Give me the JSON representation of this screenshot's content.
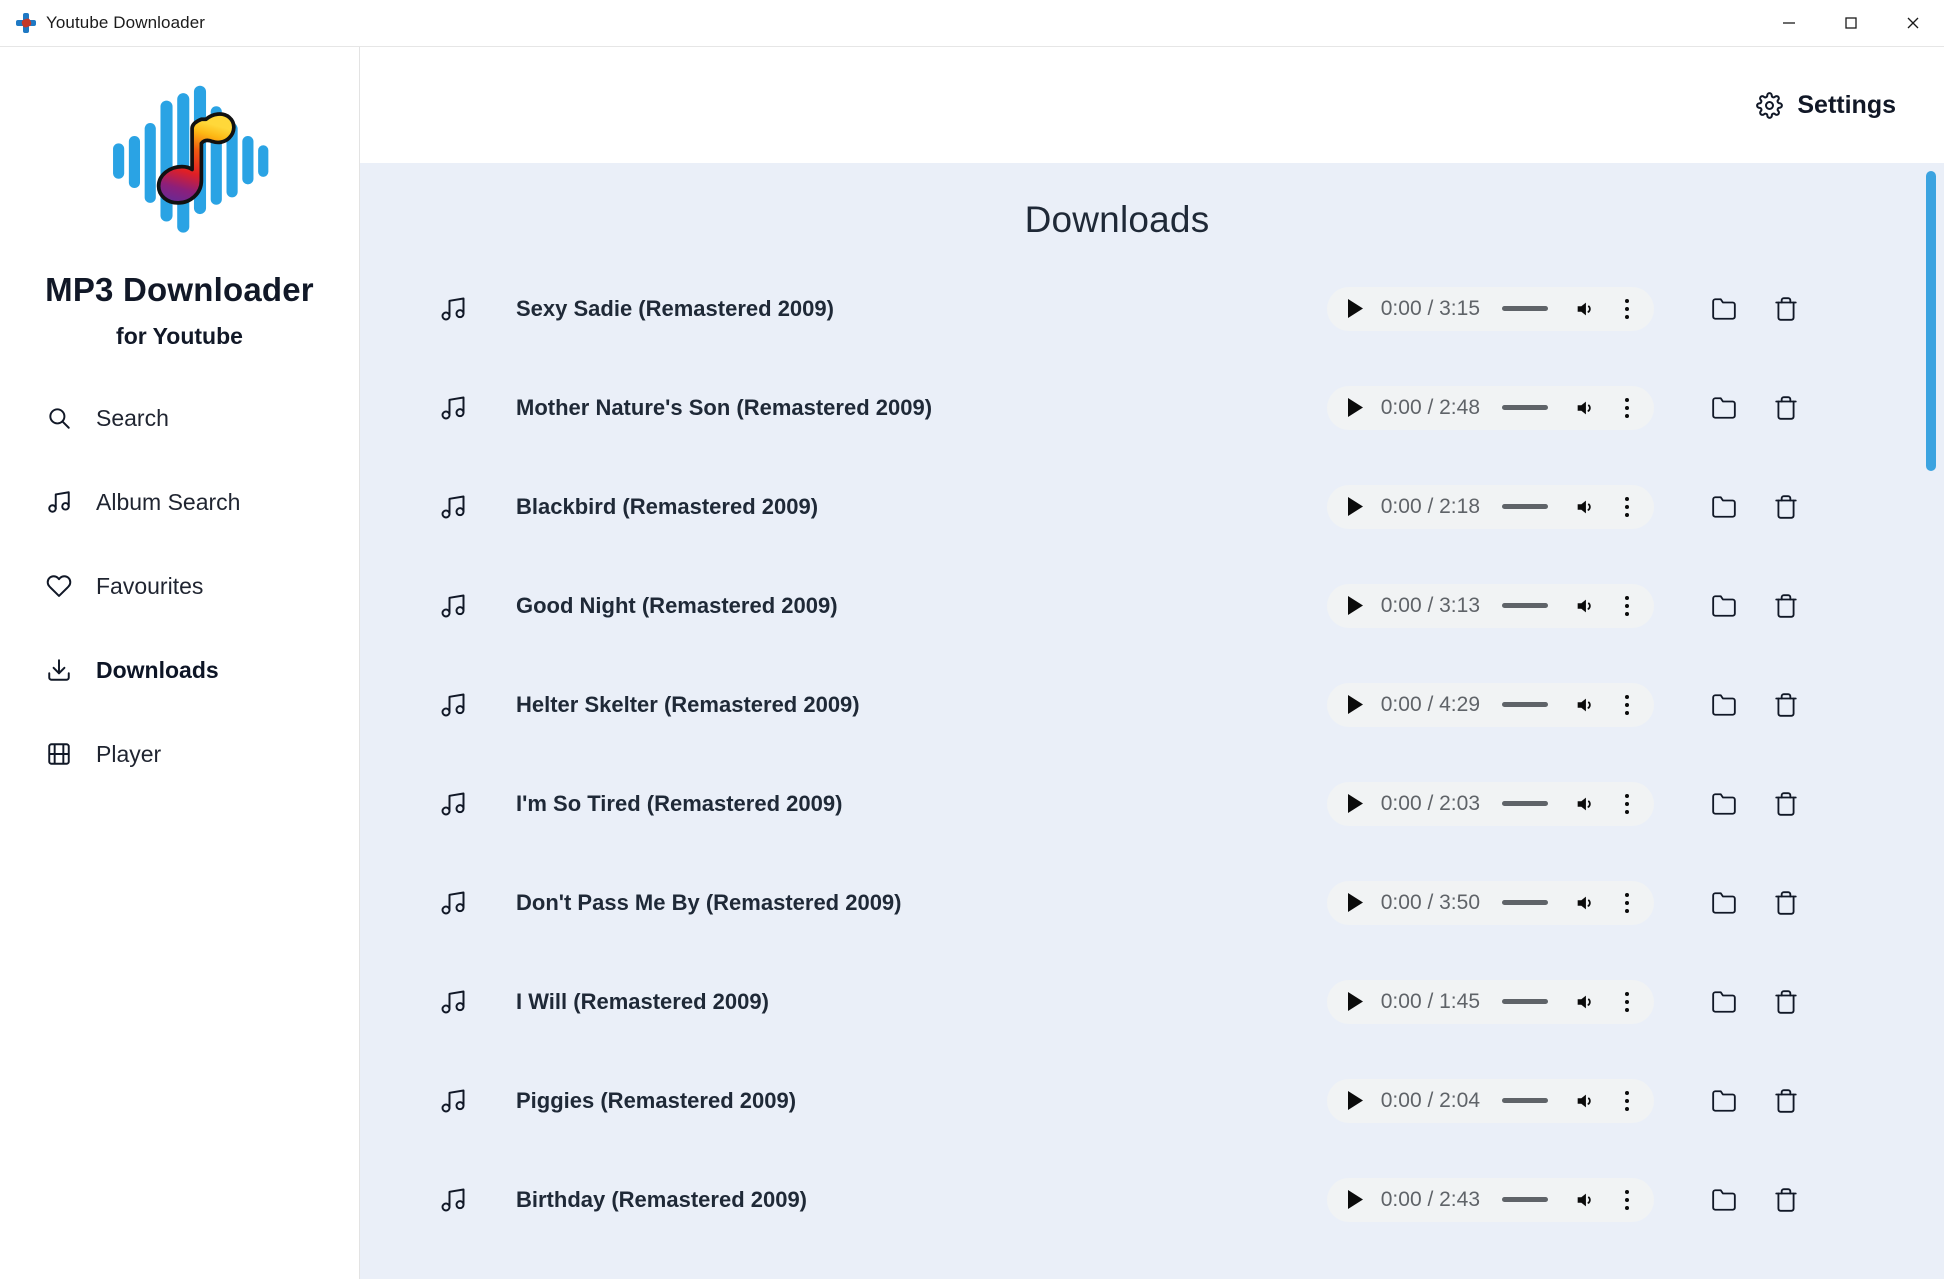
{
  "window": {
    "title": "Youtube Downloader",
    "app_icon": "app-logo-icon",
    "minimize_label": "—",
    "maximize_label": "□",
    "close_label": "×"
  },
  "sidebar": {
    "logo_icon": "waveform-music-note-logo",
    "brand": "MP3 Downloader",
    "brand_sub": "for Youtube",
    "items": [
      {
        "label": "Search",
        "icon": "search-icon",
        "active": false
      },
      {
        "label": "Album Search",
        "icon": "music-note-icon",
        "active": false
      },
      {
        "label": "Favourites",
        "icon": "heart-icon",
        "active": false
      },
      {
        "label": "Downloads",
        "icon": "download-icon",
        "active": true
      },
      {
        "label": "Player",
        "icon": "film-icon",
        "active": false
      }
    ]
  },
  "topbar": {
    "settings_label": "Settings",
    "settings_icon": "gear-icon"
  },
  "main": {
    "page_title": "Downloads",
    "colors": {
      "content_bg": "#eaeff8",
      "player_bg": "#f1f3f4",
      "scrollbar": "#3ba3e0",
      "text": "#1f2937",
      "muted": "#5f6368"
    },
    "row_controls": {
      "play_icon": "play-icon",
      "volume_icon": "volume-icon",
      "more_icon": "more-vertical-icon",
      "folder_icon": "folder-icon",
      "delete_icon": "trash-icon",
      "seek_label": "seek-slider"
    },
    "tracks": [
      {
        "title": "Sexy Sadie (Remastered 2009)",
        "time": "0:00 / 3:15"
      },
      {
        "title": "Mother Nature's Son (Remastered 2009)",
        "time": "0:00 / 2:48"
      },
      {
        "title": "Blackbird (Remastered 2009)",
        "time": "0:00 / 2:18"
      },
      {
        "title": "Good Night (Remastered 2009)",
        "time": "0:00 / 3:13"
      },
      {
        "title": "Helter Skelter (Remastered 2009)",
        "time": "0:00 / 4:29"
      },
      {
        "title": "I'm So Tired (Remastered 2009)",
        "time": "0:00 / 2:03"
      },
      {
        "title": "Don't Pass Me By (Remastered 2009)",
        "time": "0:00 / 3:50"
      },
      {
        "title": "I Will (Remastered 2009)",
        "time": "0:00 / 1:45"
      },
      {
        "title": "Piggies (Remastered 2009)",
        "time": "0:00 / 2:04"
      },
      {
        "title": "Birthday (Remastered 2009)",
        "time": "0:00 / 2:43"
      }
    ]
  }
}
